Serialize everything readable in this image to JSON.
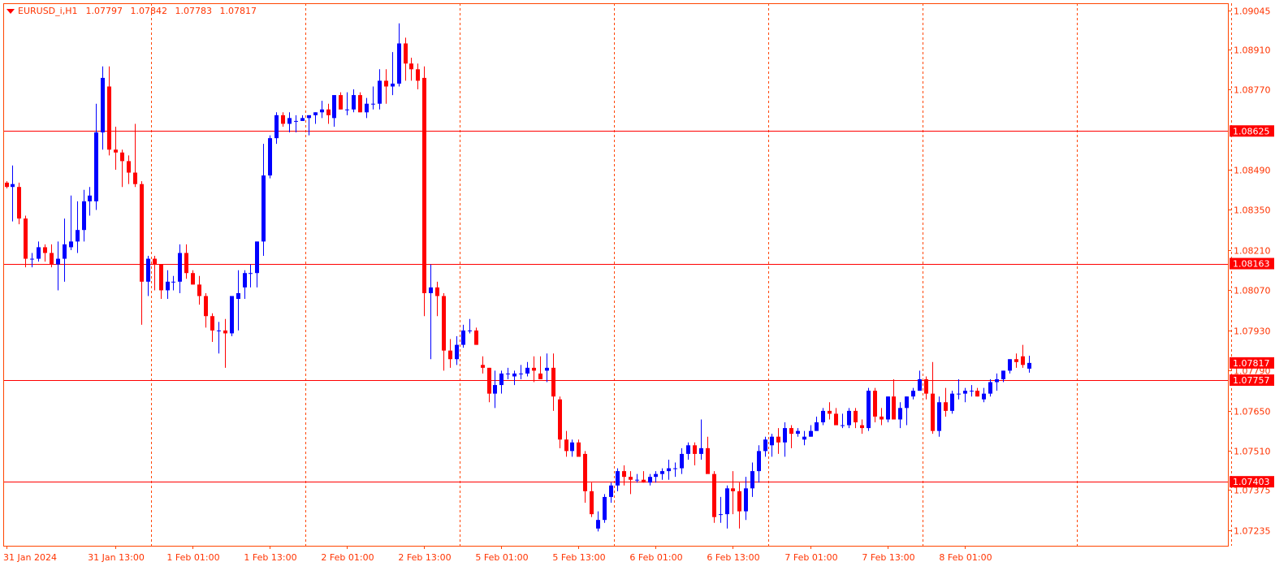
{
  "header": {
    "symbol": "EURUSD_i,H1",
    "open": "1.07797",
    "high": "1.07842",
    "low": "1.07783",
    "close": "1.07817",
    "collapse_icon": "triangle-down-icon"
  },
  "colors": {
    "bull": "#0000ff",
    "bear": "#ff0000",
    "frame": "#ff4500",
    "grid": "#ff4500",
    "hline": "#ff0000",
    "label_bg": "#ff0000",
    "label_text": "#ffffff",
    "axis_text": "#ff3300"
  },
  "chart_data": {
    "type": "candlestick",
    "timeframe": "H1",
    "ylim": [
      1.0718,
      1.0907
    ],
    "y_ticks": [
      "1.09045",
      "1.08910",
      "1.08770",
      "1.08490",
      "1.08350",
      "1.08210",
      "1.08070",
      "1.07930",
      "1.07790",
      "1.07650",
      "1.07510",
      "1.07375",
      "1.07235"
    ],
    "x_labels": [
      {
        "label": "31 Jan 2024",
        "index": 0
      },
      {
        "label": "31 Jan 13:00",
        "index": 17
      },
      {
        "label": "1 Feb 01:00",
        "index": 29
      },
      {
        "label": "1 Feb 13:00",
        "index": 41
      },
      {
        "label": "2 Feb 01:00",
        "index": 53
      },
      {
        "label": "2 Feb 13:00",
        "index": 65
      },
      {
        "label": "5 Feb 01:00",
        "index": 77
      },
      {
        "label": "5 Feb 13:00",
        "index": 89
      },
      {
        "label": "6 Feb 01:00",
        "index": 101
      },
      {
        "label": "6 Feb 13:00",
        "index": 113
      },
      {
        "label": "7 Feb 01:00",
        "index": 125
      },
      {
        "label": "7 Feb 13:00",
        "index": 137
      },
      {
        "label": "8 Feb 01:00",
        "index": 149
      }
    ],
    "day_separators": [
      23,
      47,
      71,
      95,
      119,
      143,
      167,
      191
    ],
    "horizontal_levels": [
      {
        "label": "1.08625",
        "value": 1.08625
      },
      {
        "label": "1.08163",
        "value": 1.08163
      },
      {
        "label": "1.07757",
        "value": 1.07757
      },
      {
        "label": "1.07403",
        "value": 1.07403
      }
    ],
    "current_price_label": "1.07817",
    "current_price": 1.07817,
    "candles": [
      [
        1.08445,
        1.0845,
        1.08425,
        1.0843
      ],
      [
        1.0843,
        1.08505,
        1.0831,
        1.0844
      ],
      [
        1.0843,
        1.08445,
        1.083,
        1.0832
      ],
      [
        1.0832,
        1.0833,
        1.0815,
        1.0818
      ],
      [
        1.0818,
        1.082,
        1.0815,
        1.0818
      ],
      [
        1.0818,
        1.0824,
        1.0817,
        1.0822
      ],
      [
        1.0822,
        1.0823,
        1.0817,
        1.082
      ],
      [
        1.082,
        1.0823,
        1.0815,
        1.0816
      ],
      [
        1.0816,
        1.0824,
        1.0807,
        1.0818
      ],
      [
        1.0818,
        1.0832,
        1.081,
        1.0823
      ],
      [
        1.0822,
        1.084,
        1.0821,
        1.0824
      ],
      [
        1.0824,
        1.0838,
        1.082,
        1.0828
      ],
      [
        1.0828,
        1.0842,
        1.0824,
        1.0838
      ],
      [
        1.0838,
        1.0843,
        1.0833,
        1.084
      ],
      [
        1.0838,
        1.0872,
        1.0835,
        1.0862
      ],
      [
        1.0862,
        1.0885,
        1.0856,
        1.0881
      ],
      [
        1.0878,
        1.0885,
        1.0854,
        1.0856
      ],
      [
        1.0856,
        1.0864,
        1.0849,
        1.0855
      ],
      [
        1.0855,
        1.0856,
        1.0843,
        1.0852
      ],
      [
        1.0852,
        1.0854,
        1.0844,
        1.0848
      ],
      [
        1.0848,
        1.0865,
        1.0843,
        1.0844
      ],
      [
        1.0844,
        1.0845,
        1.0795,
        1.081
      ],
      [
        1.081,
        1.0819,
        1.0805,
        1.0818
      ],
      [
        1.0818,
        1.0819,
        1.0807,
        1.0816
      ],
      [
        1.0816,
        1.0816,
        1.0804,
        1.0807
      ],
      [
        1.0807,
        1.0814,
        1.0804,
        1.081
      ],
      [
        1.081,
        1.0812,
        1.0807,
        1.081
      ],
      [
        1.081,
        1.0823,
        1.0806,
        1.082
      ],
      [
        1.082,
        1.0823,
        1.0811,
        1.0813
      ],
      [
        1.0813,
        1.0814,
        1.0809,
        1.0809
      ],
      [
        1.0809,
        1.0812,
        1.0802,
        1.0805
      ],
      [
        1.0805,
        1.0806,
        1.0794,
        1.0798
      ],
      [
        1.0798,
        1.0799,
        1.0789,
        1.0793
      ],
      [
        1.0793,
        1.0796,
        1.0785,
        1.0793
      ],
      [
        1.0793,
        1.0797,
        1.078,
        1.0792
      ],
      [
        1.0792,
        1.0805,
        1.0791,
        1.0805
      ],
      [
        1.0804,
        1.0814,
        1.0793,
        1.0806
      ],
      [
        1.0808,
        1.0814,
        1.0804,
        1.0813
      ],
      [
        1.0813,
        1.0816,
        1.0808,
        1.0813
      ],
      [
        1.0813,
        1.0824,
        1.0808,
        1.0824
      ],
      [
        1.0824,
        1.0858,
        1.0819,
        1.0847
      ],
      [
        1.0847,
        1.0861,
        1.0846,
        1.086
      ],
      [
        1.086,
        1.0869,
        1.0858,
        1.0868
      ],
      [
        1.0868,
        1.0869,
        1.0864,
        1.0865
      ],
      [
        1.0865,
        1.0869,
        1.0862,
        1.0867
      ],
      [
        1.0866,
        1.0868,
        1.0862,
        1.0866
      ],
      [
        1.0866,
        1.0868,
        1.0866,
        1.0867
      ],
      [
        1.0867,
        1.0868,
        1.0861,
        1.0868
      ],
      [
        1.0868,
        1.0869,
        1.0865,
        1.0869
      ],
      [
        1.0869,
        1.0873,
        1.0867,
        1.087
      ],
      [
        1.087,
        1.0872,
        1.0865,
        1.0868
      ],
      [
        1.0867,
        1.0875,
        1.0864,
        1.0875
      ],
      [
        1.0875,
        1.0876,
        1.087,
        1.087
      ],
      [
        1.087,
        1.0876,
        1.0868,
        1.087
      ],
      [
        1.087,
        1.0877,
        1.0869,
        1.0875
      ],
      [
        1.0875,
        1.0876,
        1.0869,
        1.0869
      ],
      [
        1.0869,
        1.0874,
        1.0867,
        1.0872
      ],
      [
        1.0872,
        1.0878,
        1.087,
        1.0872
      ],
      [
        1.0872,
        1.0884,
        1.087,
        1.088
      ],
      [
        1.088,
        1.0884,
        1.0872,
        1.0878
      ],
      [
        1.0878,
        1.089,
        1.0875,
        1.0879
      ],
      [
        1.0879,
        1.09,
        1.0878,
        1.0893
      ],
      [
        1.0893,
        1.0895,
        1.088,
        1.0886
      ],
      [
        1.0886,
        1.0888,
        1.088,
        1.0884
      ],
      [
        1.0884,
        1.0886,
        1.0877,
        1.088
      ],
      [
        1.0881,
        1.0885,
        1.0798,
        1.0806
      ],
      [
        1.0806,
        1.0816,
        1.0783,
        1.0808
      ],
      [
        1.0808,
        1.081,
        1.0798,
        1.0805
      ],
      [
        1.0805,
        1.0806,
        1.0779,
        1.0786
      ],
      [
        1.0786,
        1.079,
        1.078,
        1.0783
      ],
      [
        1.0783,
        1.0791,
        1.0781,
        1.0788
      ],
      [
        1.0788,
        1.0795,
        1.0787,
        1.0793
      ],
      [
        1.0793,
        1.0797,
        1.0792,
        1.0793
      ],
      [
        1.0793,
        1.0794,
        1.0788,
        1.0788
      ],
      [
        1.0781,
        1.0784,
        1.0778,
        1.078
      ],
      [
        1.078,
        1.078,
        1.0768,
        1.0771
      ],
      [
        1.0771,
        1.0779,
        1.0766,
        1.0774
      ],
      [
        1.0774,
        1.0779,
        1.0771,
        1.0778
      ],
      [
        1.0778,
        1.078,
        1.0776,
        1.0778
      ],
      [
        1.0777,
        1.0779,
        1.0774,
        1.0778
      ],
      [
        1.0778,
        1.0781,
        1.0776,
        1.0778
      ],
      [
        1.0778,
        1.0782,
        1.0777,
        1.078
      ],
      [
        1.078,
        1.0784,
        1.0775,
        1.0779
      ],
      [
        1.0778,
        1.0784,
        1.0777,
        1.0776
      ],
      [
        1.0779,
        1.0785,
        1.0775,
        1.078
      ],
      [
        1.078,
        1.0785,
        1.0765,
        1.077
      ],
      [
        1.0769,
        1.077,
        1.0752,
        1.0755
      ],
      [
        1.0755,
        1.0758,
        1.0749,
        1.0751
      ],
      [
        1.0751,
        1.0755,
        1.0749,
        1.0754
      ],
      [
        1.0754,
        1.0755,
        1.075,
        1.0749
      ],
      [
        1.075,
        1.0751,
        1.0733,
        1.0737
      ],
      [
        1.0737,
        1.074,
        1.0728,
        1.0729
      ],
      [
        1.0724,
        1.073,
        1.0723,
        1.0727
      ],
      [
        1.0727,
        1.0736,
        1.0726,
        1.0735
      ],
      [
        1.0735,
        1.074,
        1.0733,
        1.0739
      ],
      [
        1.0739,
        1.0745,
        1.0737,
        1.0744
      ],
      [
        1.0744,
        1.0746,
        1.0739,
        1.0742
      ],
      [
        1.0742,
        1.0744,
        1.0736,
        1.0741
      ],
      [
        1.0741,
        1.0743,
        1.074,
        1.0741
      ],
      [
        1.0741,
        1.0744,
        1.074,
        1.074
      ],
      [
        1.074,
        1.0743,
        1.0739,
        1.0742
      ],
      [
        1.0742,
        1.0744,
        1.074,
        1.0743
      ],
      [
        1.0743,
        1.0745,
        1.0741,
        1.0744
      ],
      [
        1.0744,
        1.0748,
        1.0741,
        1.0745
      ],
      [
        1.0745,
        1.0747,
        1.0742,
        1.0745
      ],
      [
        1.0745,
        1.0752,
        1.0743,
        1.075
      ],
      [
        1.075,
        1.0754,
        1.0748,
        1.0753
      ],
      [
        1.0753,
        1.0754,
        1.0746,
        1.075
      ],
      [
        1.075,
        1.0762,
        1.0748,
        1.0752
      ],
      [
        1.0752,
        1.0756,
        1.0745,
        1.0743
      ],
      [
        1.0743,
        1.0744,
        1.0726,
        1.0728
      ],
      [
        1.0729,
        1.0735,
        1.0726,
        1.0729
      ],
      [
        1.0729,
        1.0739,
        1.0724,
        1.0738
      ],
      [
        1.0738,
        1.0744,
        1.0729,
        1.0737
      ],
      [
        1.0737,
        1.074,
        1.0724,
        1.073
      ],
      [
        1.073,
        1.0742,
        1.0727,
        1.0738
      ],
      [
        1.0738,
        1.0747,
        1.0735,
        1.0744
      ],
      [
        1.0744,
        1.0753,
        1.074,
        1.0751
      ],
      [
        1.0751,
        1.0756,
        1.0749,
        1.0755
      ],
      [
        1.0753,
        1.0757,
        1.0749,
        1.0756
      ],
      [
        1.0756,
        1.0759,
        1.075,
        1.0754
      ],
      [
        1.0754,
        1.0761,
        1.0749,
        1.0759
      ],
      [
        1.0759,
        1.076,
        1.0752,
        1.0757
      ],
      [
        1.0757,
        1.0759,
        1.0756,
        1.0758
      ],
      [
        1.0755,
        1.0758,
        1.0753,
        1.0756
      ],
      [
        1.0756,
        1.076,
        1.0756,
        1.0758
      ],
      [
        1.0758,
        1.0763,
        1.0758,
        1.0761
      ],
      [
        1.0761,
        1.0766,
        1.076,
        1.0765
      ],
      [
        1.0765,
        1.0768,
        1.0762,
        1.0764
      ],
      [
        1.0764,
        1.0766,
        1.076,
        1.076
      ],
      [
        1.076,
        1.0764,
        1.0759,
        1.076
      ],
      [
        1.076,
        1.0766,
        1.0759,
        1.0765
      ],
      [
        1.0765,
        1.0766,
        1.0759,
        1.0761
      ],
      [
        1.076,
        1.0762,
        1.0757,
        1.0759
      ],
      [
        1.0759,
        1.0773,
        1.0758,
        1.0772
      ],
      [
        1.0772,
        1.0773,
        1.0761,
        1.0763
      ],
      [
        1.0763,
        1.0766,
        1.076,
        1.0762
      ],
      [
        1.0762,
        1.077,
        1.0761,
        1.077
      ],
      [
        1.077,
        1.0776,
        1.0762,
        1.0762
      ],
      [
        1.0762,
        1.0768,
        1.0759,
        1.0766
      ],
      [
        1.0766,
        1.077,
        1.076,
        1.077
      ],
      [
        1.077,
        1.0773,
        1.0769,
        1.0772
      ],
      [
        1.0772,
        1.0779,
        1.0772,
        1.0776
      ],
      [
        1.0776,
        1.0777,
        1.0769,
        1.0771
      ],
      [
        1.0771,
        1.0782,
        1.0757,
        1.0758
      ],
      [
        1.0758,
        1.077,
        1.0756,
        1.0768
      ],
      [
        1.0768,
        1.0773,
        1.0763,
        1.0765
      ],
      [
        1.0765,
        1.0772,
        1.0764,
        1.0771
      ],
      [
        1.0771,
        1.0776,
        1.0769,
        1.0771
      ],
      [
        1.0771,
        1.0773,
        1.0768,
        1.0772
      ],
      [
        1.0772,
        1.0774,
        1.077,
        1.0772
      ],
      [
        1.0772,
        1.0773,
        1.077,
        1.077
      ],
      [
        1.0769,
        1.0773,
        1.0768,
        1.0771
      ],
      [
        1.0771,
        1.0776,
        1.077,
        1.0775
      ],
      [
        1.0775,
        1.0778,
        1.0772,
        1.0776
      ],
      [
        1.0776,
        1.0779,
        1.0775,
        1.0779
      ],
      [
        1.0779,
        1.0783,
        1.0778,
        1.0783
      ],
      [
        1.0783,
        1.0785,
        1.078,
        1.0782
      ],
      [
        1.0784,
        1.0788,
        1.078,
        1.0781
      ],
      [
        1.07797,
        1.07842,
        1.07783,
        1.07817
      ]
    ]
  }
}
